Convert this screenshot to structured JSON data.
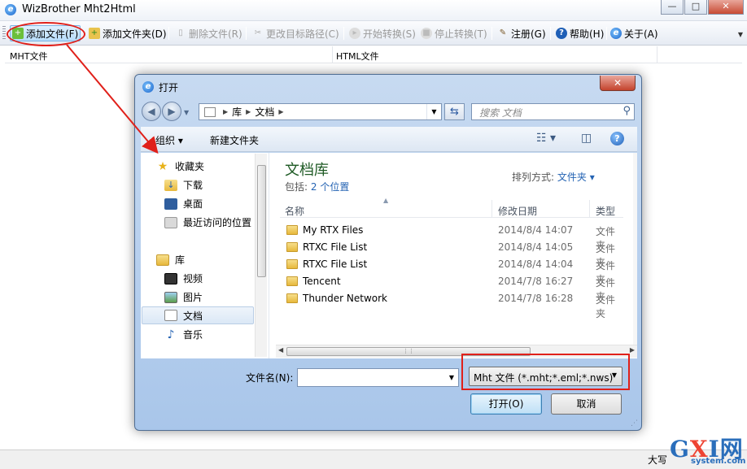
{
  "app": {
    "title": "WizBrother Mht2Html",
    "title_icon": "ie-icon",
    "window_buttons": {
      "minimize": "—",
      "maximize": "□",
      "close": "✕"
    }
  },
  "toolbar": {
    "items": [
      {
        "label": "添加文件(F)",
        "icon": "add-file-icon",
        "enabled": true
      },
      {
        "label": "添加文件夹(D)",
        "icon": "add-folder-icon",
        "enabled": true
      },
      {
        "label": "删除文件(R)",
        "icon": "delete-file-icon",
        "enabled": false
      },
      {
        "label": "更改目标路径(C)",
        "icon": "change-path-icon",
        "enabled": false
      },
      {
        "label": "开始转换(S)",
        "icon": "start-icon",
        "enabled": false
      },
      {
        "label": "停止转换(T)",
        "icon": "stop-icon",
        "enabled": false
      },
      {
        "label": "注册(G)",
        "icon": "register-icon",
        "enabled": true
      },
      {
        "label": "帮助(H)",
        "icon": "help-icon",
        "enabled": true
      },
      {
        "label": "关于(A)",
        "icon": "about-icon",
        "enabled": true
      }
    ]
  },
  "list": {
    "columns": [
      "MHT文件",
      "HTML文件"
    ]
  },
  "statusbar": {
    "caps": "大写"
  },
  "watermark": {
    "brand": "GXI网",
    "brand_g": "G",
    "brand_x": "X",
    "brand_rest": "I网",
    "domain": "system.com"
  },
  "dialog": {
    "title": "打开",
    "close": "✕",
    "address": {
      "root": "库",
      "current": "文档"
    },
    "search_placeholder": "搜索 文档",
    "commands": {
      "organize": "组织 ▾",
      "new_folder": "新建文件夹"
    },
    "nav": {
      "favorites": "收藏夹",
      "downloads": "下载",
      "desktop": "桌面",
      "recent": "最近访问的位置",
      "libraries": "库",
      "videos": "视频",
      "pictures": "图片",
      "documents": "文档",
      "music": "音乐"
    },
    "library": {
      "title": "文档库",
      "includes_label": "包括:",
      "includes_link": "2 个位置",
      "arrange_label": "排列方式:",
      "arrange_value": "文件夹 ▾"
    },
    "columns": {
      "name": "名称",
      "date": "修改日期",
      "type": "类型"
    },
    "files": [
      {
        "name": "My RTX Files",
        "date": "2014/8/4 14:07",
        "type": "文件夹"
      },
      {
        "name": "RTXC File List",
        "date": "2014/8/4 14:05",
        "type": "文件夹"
      },
      {
        "name": "RTXC File List",
        "date": "2014/8/4 14:04",
        "type": "文件夹"
      },
      {
        "name": "Tencent",
        "date": "2014/7/8 16:27",
        "type": "文件夹"
      },
      {
        "name": "Thunder Network",
        "date": "2014/7/8 16:28",
        "type": "文件夹"
      }
    ],
    "filename_label": "文件名(N):",
    "filename_value": "",
    "filetype": "Mht 文件 (*.mht;*.eml;*.nws)",
    "open_button": "打开(O)",
    "cancel_button": "取消"
  },
  "colors": {
    "annotation": "#e0201a",
    "link": "#2463b3",
    "library_title": "#1e5a24"
  }
}
